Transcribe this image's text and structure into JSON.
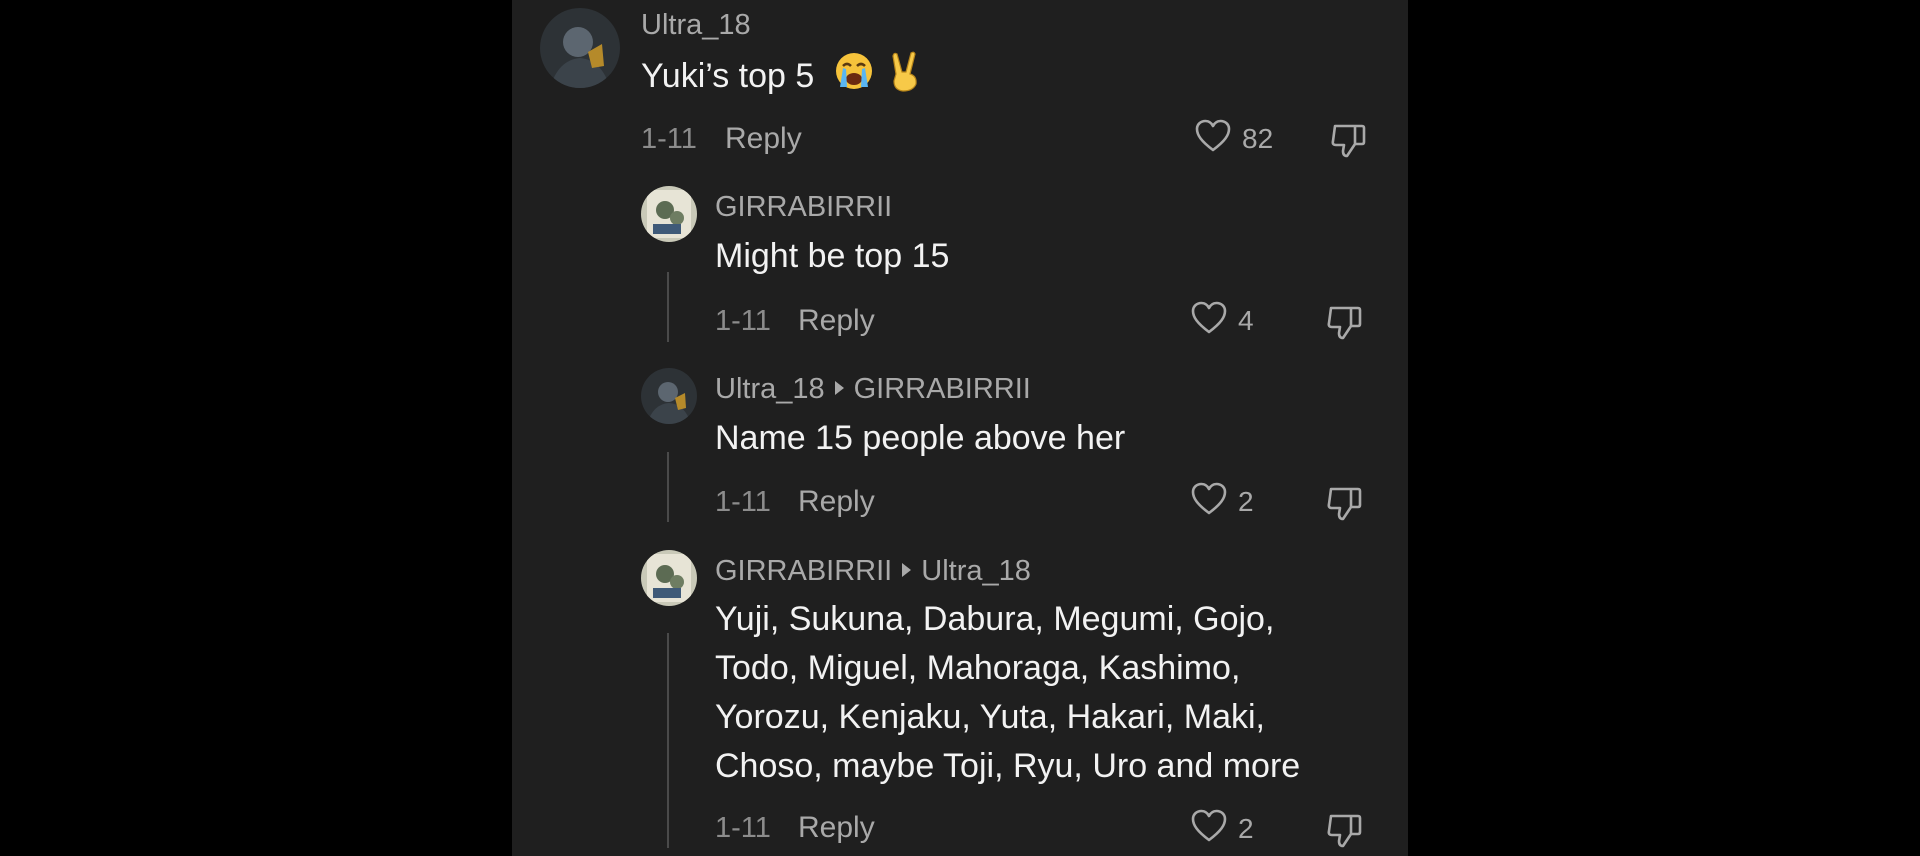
{
  "comments": [
    {
      "username": "Ultra_18",
      "reply_to": "",
      "text_lines": [
        "Yuki’s top 5"
      ],
      "emojis": [
        "loudly-crying-face",
        "victory-hand"
      ],
      "date": "1-11",
      "reply_label": "Reply",
      "likes": "82"
    },
    {
      "username": "GIRRABIRRII",
      "reply_to": "",
      "text_lines": [
        "Might be top 15"
      ],
      "date": "1-11",
      "reply_label": "Reply",
      "likes": "4"
    },
    {
      "username": "Ultra_18",
      "reply_to": "GIRRABIRRII",
      "text_lines": [
        "Name 15 people above her"
      ],
      "date": "1-11",
      "reply_label": "Reply",
      "likes": "2"
    },
    {
      "username": "GIRRABIRRII",
      "reply_to": "Ultra_18",
      "text_lines": [
        "Yuji, Sukuna, Dabura, Megumi, Gojo,",
        "Todo, Miguel, Mahoraga, Kashimo,",
        "Yorozu, Kenjaku, Yuta, Hakari, Maki,",
        "Choso, maybe Toji, Ryu, Uro and more"
      ],
      "date": "1-11",
      "reply_label": "Reply",
      "likes": "2"
    }
  ],
  "colors": {
    "background": "#000000",
    "panel": "#1f1f1f",
    "text_primary": "#f2f2f2",
    "text_secondary": "#a9a9a9"
  }
}
